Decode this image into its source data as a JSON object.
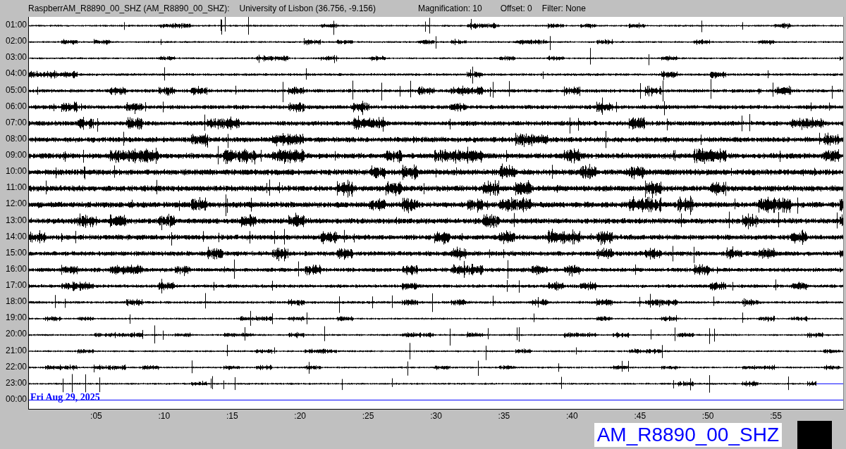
{
  "header": {
    "station": "RaspberrAM_R8890_00_SHZ (AM_R8890_00_SHZ):",
    "location": "University of Lisbon (36.756, -9.156)",
    "magnification": "Magnification: 10",
    "offset": "Offset: 0",
    "filter": "Filter: None"
  },
  "rows": [
    {
      "label": "01:00",
      "kind": "full"
    },
    {
      "label": "02:00",
      "kind": "full"
    },
    {
      "label": "03:00",
      "kind": "full"
    },
    {
      "label": "04:00",
      "kind": "full"
    },
    {
      "label": "05:00",
      "kind": "full"
    },
    {
      "label": "06:00",
      "kind": "full"
    },
    {
      "label": "07:00",
      "kind": "full"
    },
    {
      "label": "08:00",
      "kind": "full"
    },
    {
      "label": "09:00",
      "kind": "full"
    },
    {
      "label": "10:00",
      "kind": "full"
    },
    {
      "label": "11:00",
      "kind": "full"
    },
    {
      "label": "12:00",
      "kind": "full"
    },
    {
      "label": "13:00",
      "kind": "full"
    },
    {
      "label": "14:00",
      "kind": "full"
    },
    {
      "label": "15:00",
      "kind": "full"
    },
    {
      "label": "16:00",
      "kind": "full"
    },
    {
      "label": "17:00",
      "kind": "full"
    },
    {
      "label": "18:00",
      "kind": "full"
    },
    {
      "label": "19:00",
      "kind": "full"
    },
    {
      "label": "20:00",
      "kind": "full"
    },
    {
      "label": "21:00",
      "kind": "full"
    },
    {
      "label": "22:00",
      "kind": "full"
    },
    {
      "label": "23:00",
      "kind": "partial"
    },
    {
      "label": "00:00",
      "kind": "empty"
    }
  ],
  "date": "Fri Aug 29, 2025",
  "xticks": [
    ":05",
    ":10",
    ":15",
    ":20",
    ":25",
    ":30",
    ":35",
    ":40",
    ":45",
    ":50",
    ":55"
  ],
  "station_label": "AM_R8890_00_SHZ"
}
